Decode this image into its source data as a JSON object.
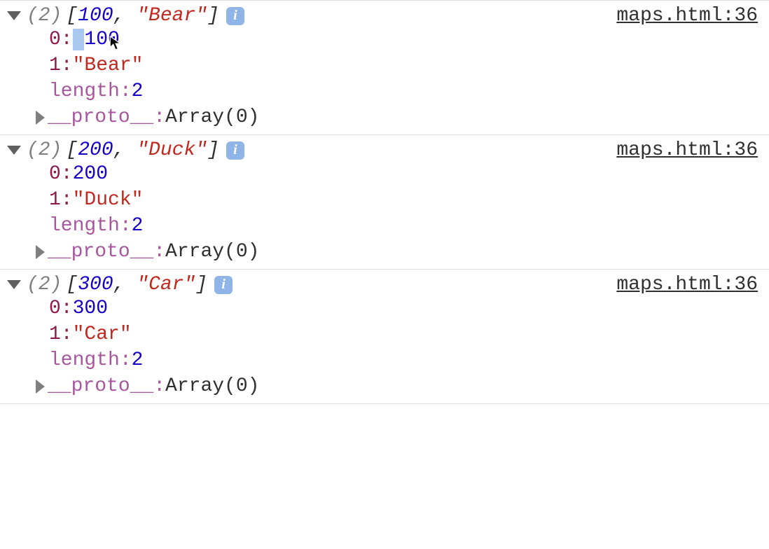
{
  "source_link": "maps.html:36",
  "info_badge": "i",
  "entries": [
    {
      "expanded": true,
      "count_label": "(2)",
      "preview_num": "100",
      "preview_str": "\"Bear\"",
      "items": [
        {
          "key": "0: ",
          "valnum": "100",
          "selected_prefix": true
        },
        {
          "key": "1: ",
          "valstr": "\"Bear\""
        }
      ],
      "length_key": "length",
      "length_val": "2",
      "proto_key": "__proto__",
      "proto_val": "Array(0)"
    },
    {
      "expanded": true,
      "count_label": "(2)",
      "preview_num": "200",
      "preview_str": "\"Duck\"",
      "items": [
        {
          "key": "0: ",
          "valnum": "200"
        },
        {
          "key": "1: ",
          "valstr": "\"Duck\""
        }
      ],
      "length_key": "length",
      "length_val": "2",
      "proto_key": "__proto__",
      "proto_val": "Array(0)"
    },
    {
      "expanded": true,
      "count_label": "(2)",
      "preview_num": "300",
      "preview_str": "\"Car\"",
      "items": [
        {
          "key": "0: ",
          "valnum": "300"
        },
        {
          "key": "1: ",
          "valstr": "\"Car\""
        }
      ],
      "length_key": "length",
      "length_val": "2",
      "proto_key": "__proto__",
      "proto_val": "Array(0)"
    }
  ]
}
